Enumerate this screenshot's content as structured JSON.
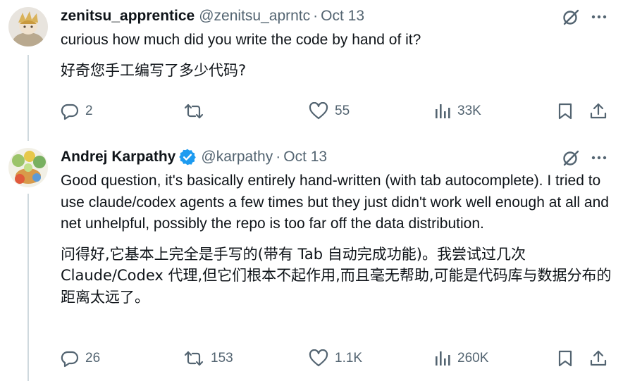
{
  "tweets": [
    {
      "display_name": "zenitsu_apprentice",
      "handle": "@zenitsu_aprntc",
      "separator": "·",
      "date": "Oct 13",
      "verified": false,
      "text_en": "curious how much did you write the code by hand of it?",
      "text_cn": "好奇您手工编写了多少代码?",
      "replies": "2",
      "retweets": "",
      "likes": "55",
      "views": "33K"
    },
    {
      "display_name": "Andrej Karpathy",
      "handle": "@karpathy",
      "separator": "·",
      "date": "Oct 13",
      "verified": true,
      "text_en": "Good question, it's basically entirely hand-written (with tab autocomplete). I tried to use claude/codex agents a few times but they just didn't work well enough at all and net unhelpful, possibly the repo is too far off the data distribution.",
      "text_cn": "问得好,它基本上完全是手写的(带有 Tab 自动完成功能)。我尝试过几次 Claude/Codex 代理,但它们根本不起作用,而且毫无帮助,可能是代码库与数据分布的距离太远了。",
      "replies": "26",
      "retweets": "153",
      "likes": "1.1K",
      "views": "260K"
    }
  ],
  "colors": {
    "text": "#0f1419",
    "muted": "#536471",
    "verified": "#1d9bf0",
    "thread_line": "#cfd9de"
  },
  "icons": [
    "grok-icon",
    "more-icon",
    "reply-icon",
    "retweet-icon",
    "like-icon",
    "views-icon",
    "bookmark-icon",
    "share-icon",
    "verified-badge-icon"
  ]
}
